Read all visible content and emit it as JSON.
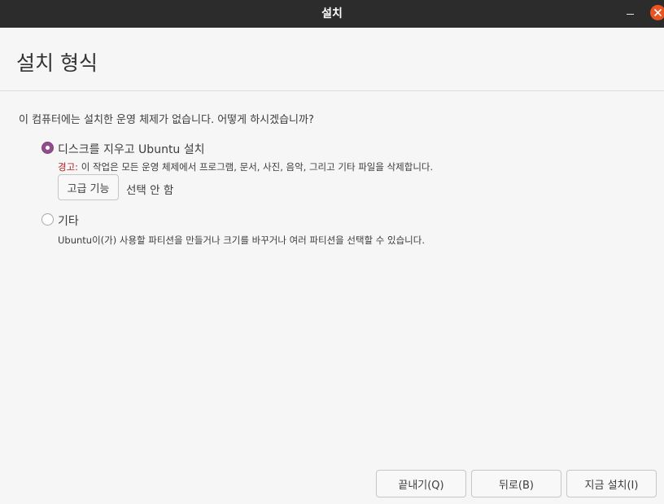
{
  "window": {
    "title": "설치"
  },
  "page": {
    "heading": "설치 형식",
    "question": "이 컴퓨터에는 설치한 운영 체제가 없습니다. 어떻게 하시겠습니까?"
  },
  "options": [
    {
      "label": "디스크를 지우고 Ubuntu 설치",
      "selected": true,
      "warning_prefix": "경고:",
      "description": " 이 작업은 모든 운영 체제에서 프로그램, 문서, 사진, 음악, 그리고 기타 파일을 삭제합니다.",
      "advanced_button": "고급 기능",
      "advanced_status": "선택 안 함"
    },
    {
      "label": "기타",
      "selected": false,
      "description": "Ubuntu이(가) 사용할 파티션을 만들거나 크기를 바꾸거나 여러 파티션을 선택할 수 있습니다."
    }
  ],
  "footer": {
    "quit_label": "끝내기(Q)",
    "back_label": "뒤로(B)",
    "install_label": "지금 설치(I)"
  },
  "colors": {
    "titlebar": "#2c2c2c",
    "close_button": "#e95420",
    "radio_selected": "#924d8b",
    "warning_text": "#b21d1d"
  },
  "icons": {
    "minimize": "minimize-icon",
    "close": "close-icon"
  }
}
